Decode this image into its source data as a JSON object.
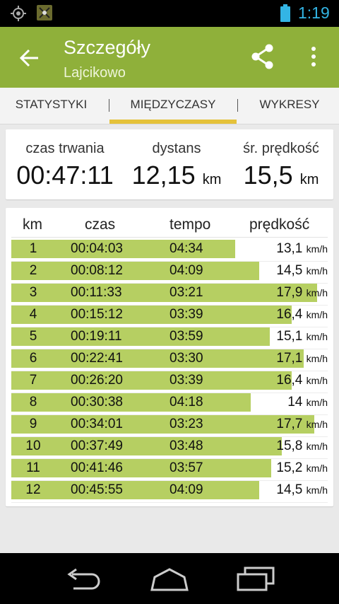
{
  "status_bar": {
    "time": "1:19",
    "icons": [
      "gps-icon",
      "app-compass-icon",
      "battery-icon"
    ],
    "time_color": "#33b5e5"
  },
  "action_bar": {
    "title": "Szczegóły",
    "subtitle": "Lajcikowo",
    "color": "#8fb03a",
    "icons": [
      "back-arrow-icon",
      "share-icon",
      "overflow-menu-icon"
    ]
  },
  "tabs": [
    {
      "label": "STATYSTYKI",
      "selected": false
    },
    {
      "label": "MIĘDZYCZASY",
      "selected": true
    },
    {
      "label": "WYKRESY",
      "selected": false
    }
  ],
  "summary": {
    "duration_label": "czas trwania",
    "duration_value": "00:47:11",
    "distance_label": "dystans",
    "distance_value": "12,15",
    "distance_unit": "km",
    "speed_label": "śr. prędkość",
    "speed_value": "15,5",
    "speed_unit": "km"
  },
  "splits": {
    "headers": {
      "km": "km",
      "czas": "czas",
      "tempo": "tempo",
      "speed": "prędkość"
    },
    "unit": "km/h",
    "bar_color": "#b6cf62",
    "max_speed": 18.5,
    "rows": [
      {
        "km": "1",
        "czas": "00:04:03",
        "tempo": "04:34",
        "speed": "13,1",
        "speed_num": 13.1
      },
      {
        "km": "2",
        "czas": "00:08:12",
        "tempo": "04:09",
        "speed": "14,5",
        "speed_num": 14.5
      },
      {
        "km": "3",
        "czas": "00:11:33",
        "tempo": "03:21",
        "speed": "17,9",
        "speed_num": 17.9
      },
      {
        "km": "4",
        "czas": "00:15:12",
        "tempo": "03:39",
        "speed": "16,4",
        "speed_num": 16.4
      },
      {
        "km": "5",
        "czas": "00:19:11",
        "tempo": "03:59",
        "speed": "15,1",
        "speed_num": 15.1
      },
      {
        "km": "6",
        "czas": "00:22:41",
        "tempo": "03:30",
        "speed": "17,1",
        "speed_num": 17.1
      },
      {
        "km": "7",
        "czas": "00:26:20",
        "tempo": "03:39",
        "speed": "16,4",
        "speed_num": 16.4
      },
      {
        "km": "8",
        "czas": "00:30:38",
        "tempo": "04:18",
        "speed": "14",
        "speed_num": 14.0
      },
      {
        "km": "9",
        "czas": "00:34:01",
        "tempo": "03:23",
        "speed": "17,7",
        "speed_num": 17.7
      },
      {
        "km": "10",
        "czas": "00:37:49",
        "tempo": "03:48",
        "speed": "15,8",
        "speed_num": 15.8
      },
      {
        "km": "11",
        "czas": "00:41:46",
        "tempo": "03:57",
        "speed": "15,2",
        "speed_num": 15.2
      },
      {
        "km": "12",
        "czas": "00:45:55",
        "tempo": "04:09",
        "speed": "14,5",
        "speed_num": 14.5
      }
    ]
  },
  "nav_bar": {
    "icons": [
      "nav-back-icon",
      "nav-home-icon",
      "nav-recent-apps-icon"
    ]
  }
}
